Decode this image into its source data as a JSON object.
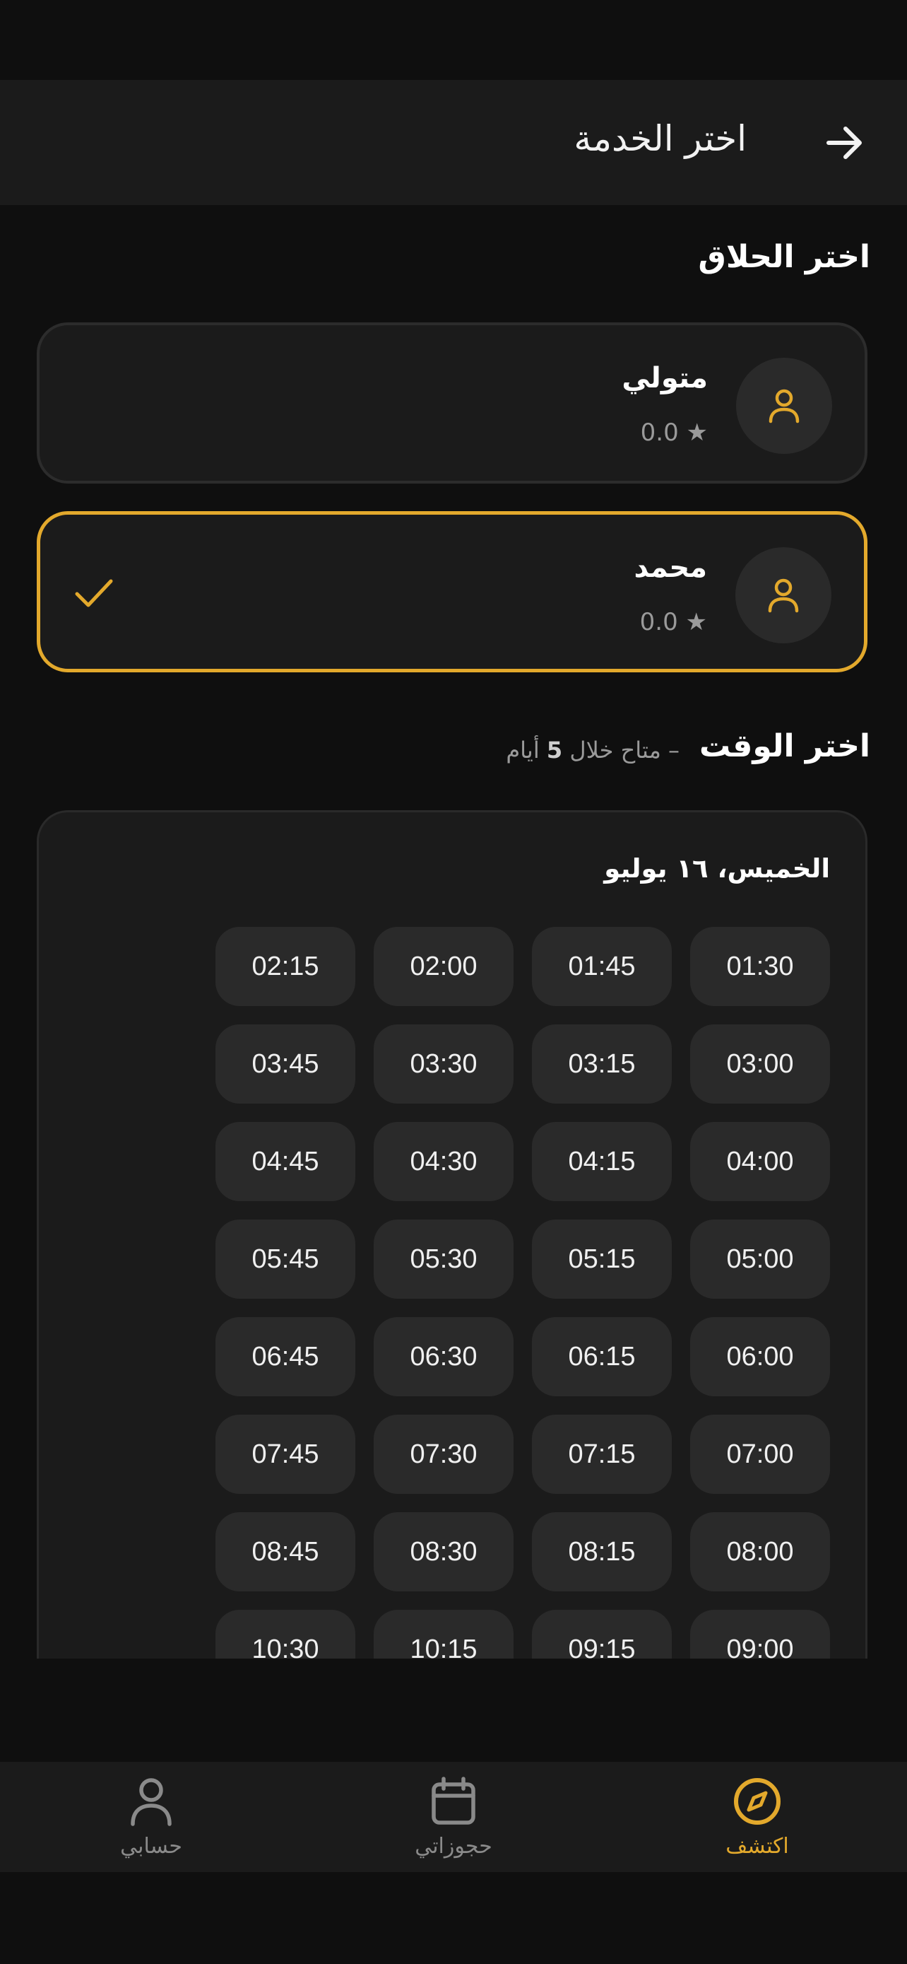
{
  "header": {
    "title": "اختر الخدمة",
    "back_icon": "arrow-right-icon"
  },
  "barber_section": {
    "title": "اختر الحلاق",
    "barbers": [
      {
        "name": "متولي",
        "rating": "0.0 ★",
        "selected": false
      },
      {
        "name": "محمد",
        "rating": "0.0 ★",
        "selected": true
      }
    ]
  },
  "time_section": {
    "title": "اختر الوقت",
    "dash": "–",
    "availability_prefix": "متاح خلال",
    "availability_days": "5",
    "availability_suffix": "أيام",
    "date": "الخميس، ١٦ يوليو",
    "slots": [
      "01:30",
      "01:45",
      "02:00",
      "02:15",
      "03:00",
      "03:15",
      "03:30",
      "03:45",
      "04:00",
      "04:15",
      "04:30",
      "04:45",
      "05:00",
      "05:15",
      "05:30",
      "05:45",
      "06:00",
      "06:15",
      "06:30",
      "06:45",
      "07:00",
      "07:15",
      "07:30",
      "07:45",
      "08:00",
      "08:15",
      "08:30",
      "08:45",
      "09:00",
      "09:15",
      "10:15",
      "10:30"
    ]
  },
  "bottom_nav": {
    "items": [
      {
        "label": "اكتشف",
        "icon": "compass-icon",
        "active": true
      },
      {
        "label": "حجوزاتي",
        "icon": "calendar-icon",
        "active": false
      },
      {
        "label": "حسابي",
        "icon": "user-icon",
        "active": false
      }
    ]
  },
  "colors": {
    "accent": "#e3a92c",
    "background": "#0f0f0f",
    "surface": "#1b1b1b",
    "muted": "#9a9a9a"
  }
}
